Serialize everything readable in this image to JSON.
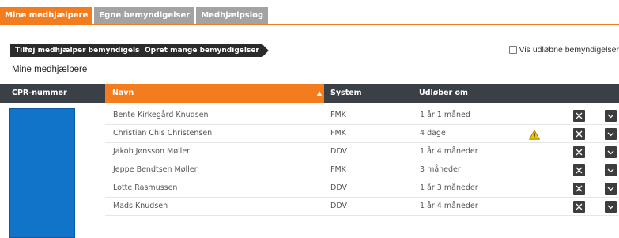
{
  "tabs": [
    {
      "label": "Mine medhjælpere",
      "active": true
    },
    {
      "label": "Egne bemyndigelser",
      "active": false
    },
    {
      "label": "Medhjælpslog",
      "active": false
    }
  ],
  "actions": {
    "add_helper_label": "Tilføj medhjælper bemyndigelser",
    "create_many_label": "Opret mange bemyndigelser"
  },
  "show_expired": {
    "label": "Vis udløbne bemyndigelser",
    "checked": false
  },
  "section_title": "Mine medhjælpere",
  "table": {
    "columns": {
      "cpr": "CPR-nummer",
      "navn": "Navn",
      "system": "System",
      "udlober": "Udløber om"
    },
    "rows": [
      {
        "navn": "Bente Kirkegård Knudsen",
        "system": "FMK",
        "udlober": "1 år 1 måned",
        "warning": false
      },
      {
        "navn": "Christian Chis Christensen",
        "system": "FMK",
        "udlober": "4 dage",
        "warning": true
      },
      {
        "navn": "Jakob Jønsson Møller",
        "system": "DDV",
        "udlober": "1 år 4 måneder",
        "warning": false
      },
      {
        "navn": "Jeppe Bendtsen Møller",
        "system": "FMK",
        "udlober": "3 måneder",
        "warning": false
      },
      {
        "navn": "Lotte Rasmussen",
        "system": "DDV",
        "udlober": "1 år 3 måneder",
        "warning": false
      },
      {
        "navn": "Mads Knudsen",
        "system": "DDV",
        "udlober": "1 år 4 måneder",
        "warning": false
      }
    ]
  },
  "colors": {
    "accent": "#f37c1f",
    "header_bg": "#3b4047",
    "redaction": "#1274c9",
    "warning": "#f5c400"
  }
}
